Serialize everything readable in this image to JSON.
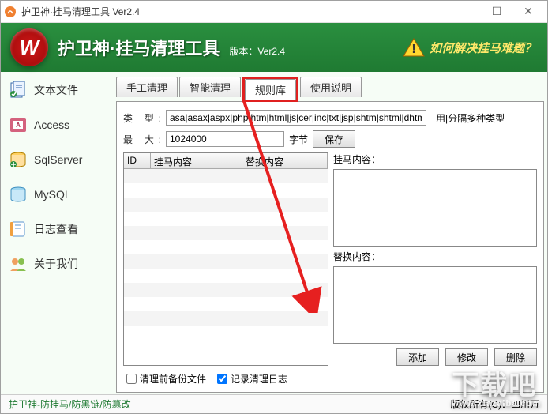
{
  "window": {
    "title": "护卫神·挂马清理工具 Ver2.4"
  },
  "header": {
    "logo_letter": "W",
    "app_name": "护卫神·挂马清理工具",
    "version_label": "版本：Ver2.4",
    "warn_text": "如何解决挂马难题？"
  },
  "sidebar": {
    "items": [
      {
        "label": "文本文件"
      },
      {
        "label": "Access"
      },
      {
        "label": "SqlServer"
      },
      {
        "label": "MySQL"
      },
      {
        "label": "日志查看"
      },
      {
        "label": "关于我们"
      }
    ]
  },
  "tabs": {
    "items": [
      {
        "label": "手工清理"
      },
      {
        "label": "智能清理"
      },
      {
        "label": "规则库"
      },
      {
        "label": "使用说明"
      }
    ],
    "active_index": 2
  },
  "panel": {
    "type_label": "类   型:",
    "type_value": "asa|asax|aspx|php|htm|html|js|cer|inc|txt|jsp|shtm|shtml|dhtml",
    "type_hint": "用|分隔多种类型",
    "max_label": "最   大:",
    "max_value": "1024000",
    "max_unit": "字节",
    "save_btn": "保存",
    "table": {
      "headers": [
        "ID",
        "挂马内容",
        "替换内容"
      ],
      "rows": []
    },
    "right_top_label": "挂马内容：",
    "right_bottom_label": "替换内容：",
    "add_btn": "添加",
    "edit_btn": "修改",
    "delete_btn": "删除",
    "backup_checkbox": "清理前备份文件",
    "log_checkbox": "记录清理日志",
    "backup_checked": false,
    "log_checked": true
  },
  "footer": {
    "link_text": "护卫神-防挂马/防黑链/防篡改",
    "copyright": "版权所有(C)：四川万"
  },
  "watermark": {
    "main": "下载吧",
    "sub": "www.xiazaiba.com"
  }
}
